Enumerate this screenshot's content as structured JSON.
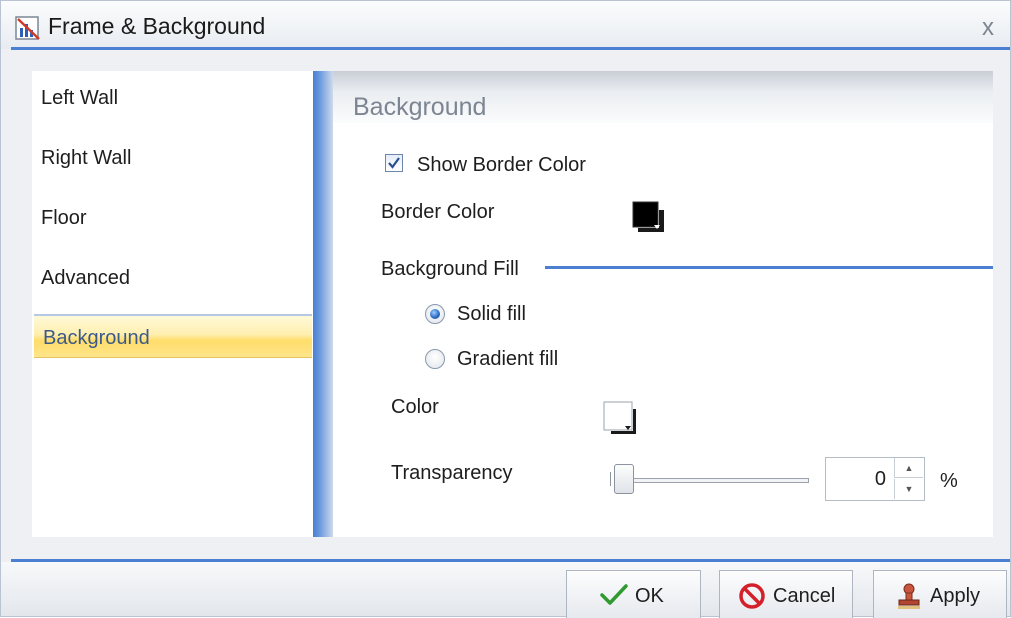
{
  "window": {
    "title": "Frame & Background",
    "close_glyph": "x"
  },
  "nav": {
    "items": [
      {
        "label": "Left Wall"
      },
      {
        "label": "Right Wall"
      },
      {
        "label": "Floor"
      },
      {
        "label": "Advanced"
      },
      {
        "label": "Background",
        "selected": true
      }
    ]
  },
  "content": {
    "section_title": "Background",
    "show_border_color": {
      "label": "Show Border Color",
      "checked": true
    },
    "border_color": {
      "label": "Border Color",
      "value": "#000000"
    },
    "background_fill": {
      "label": "Background Fill",
      "options": [
        {
          "label": "Solid fill",
          "selected": true
        },
        {
          "label": "Gradient fill",
          "selected": false
        }
      ]
    },
    "color": {
      "label": "Color",
      "value": "#ffffff"
    },
    "transparency": {
      "label": "Transparency",
      "value": "0",
      "unit": "%",
      "fraction": 0
    }
  },
  "buttons": {
    "ok": {
      "label": "OK",
      "icon": "checkmark-icon"
    },
    "cancel": {
      "label": "Cancel",
      "icon": "cancel-icon"
    },
    "apply": {
      "label": "Apply",
      "icon": "stamp-icon"
    }
  },
  "colors": {
    "accent": "#4a7fd1",
    "selection": "#ffe58a"
  }
}
